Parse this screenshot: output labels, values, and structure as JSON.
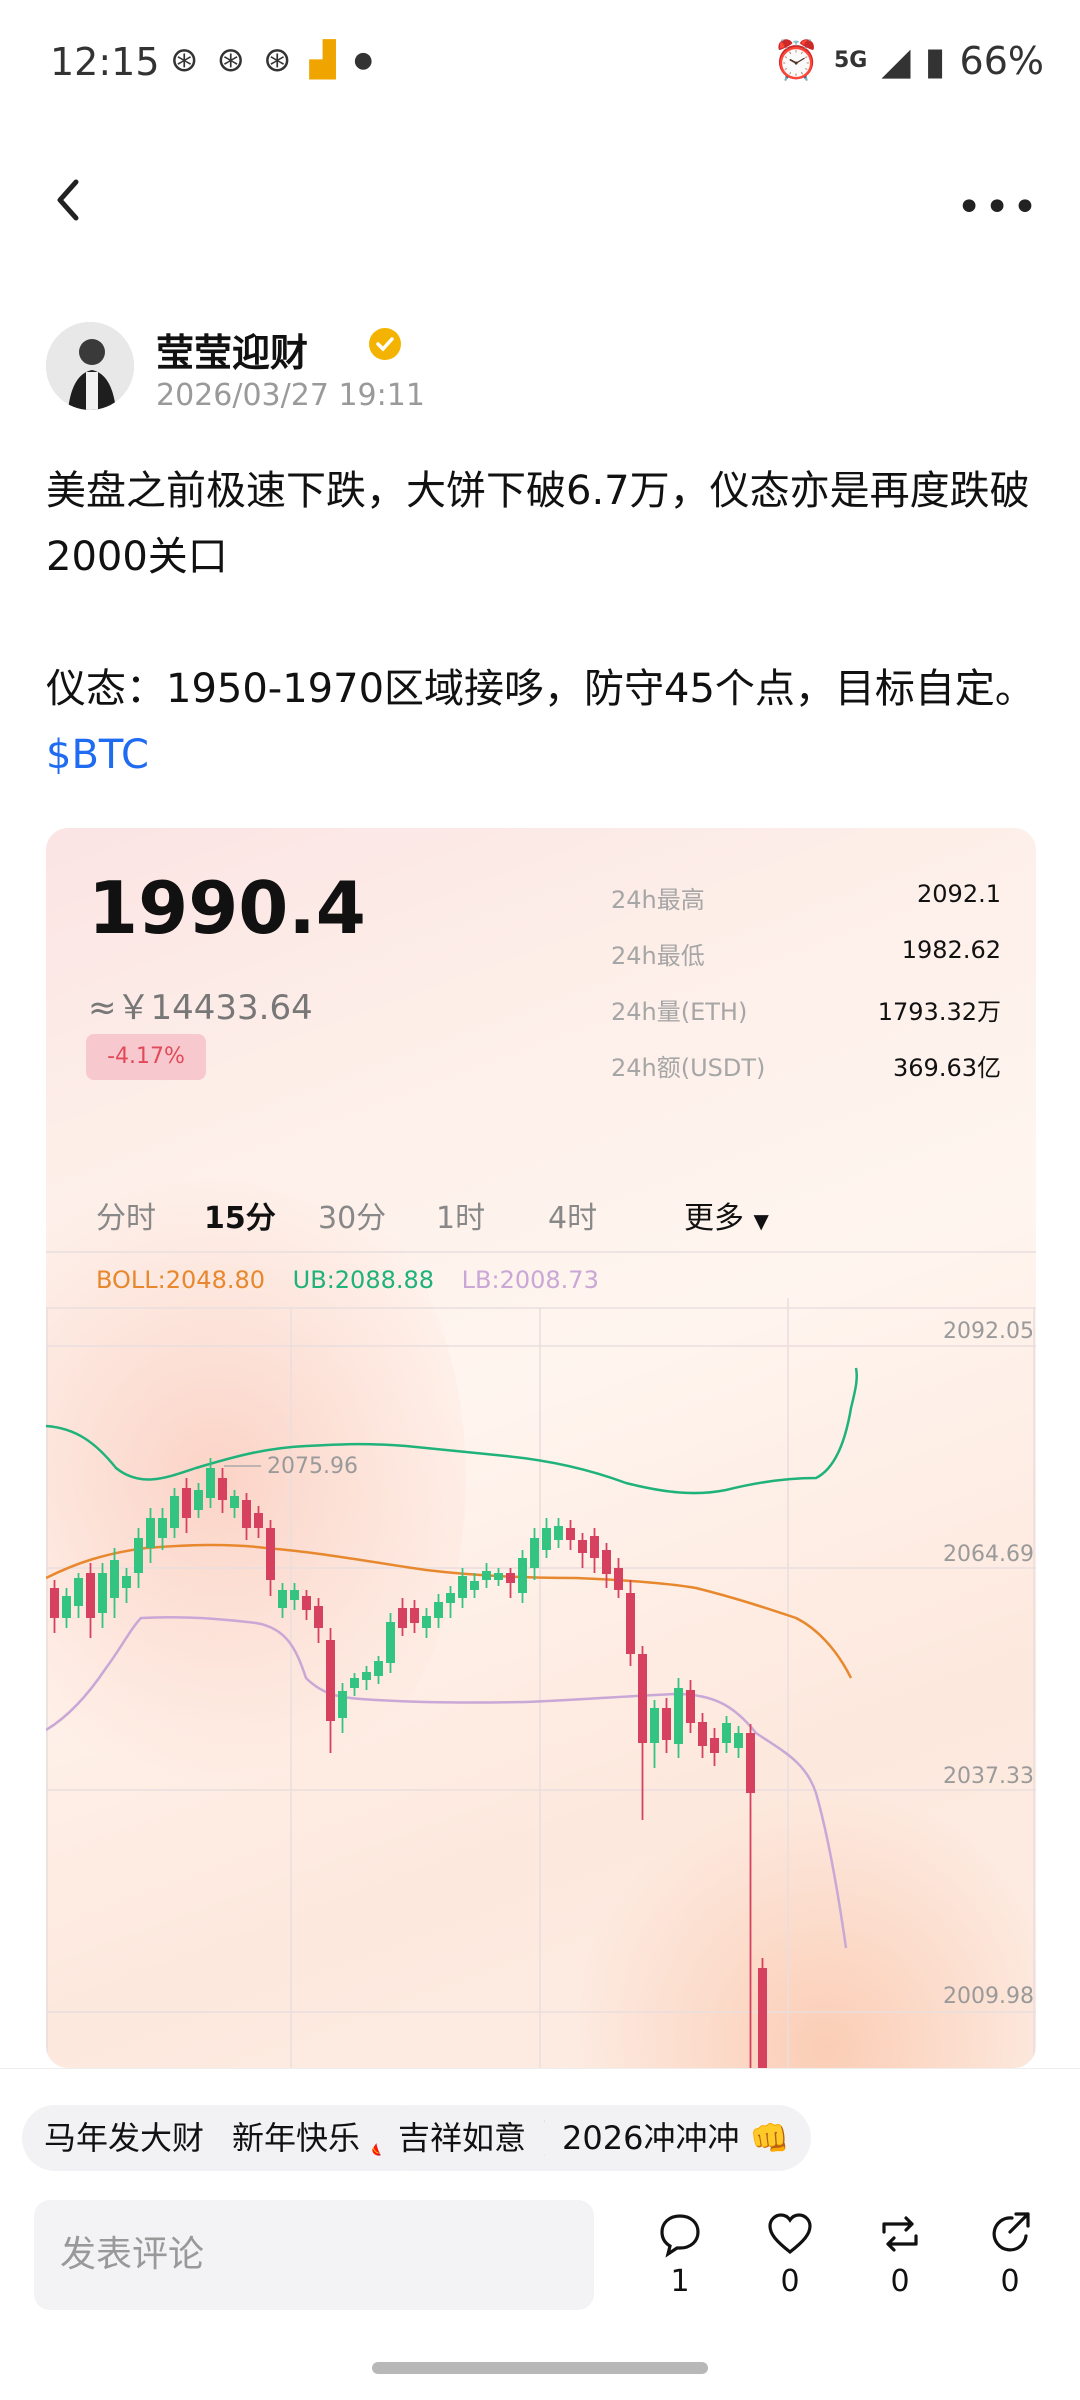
{
  "status": {
    "time": "12:15",
    "battery": "66%",
    "network": "5G"
  },
  "post": {
    "author": "莹莹迎财",
    "datetime": "2026/03/27 19:11",
    "para1": "美盘之前极速下跌，大饼下破6.7万，仪态亦是再度跌破2000关口",
    "para2": "仪态：1950-1970区域接哆，防守45个点，目标自定。",
    "ticker": "$BTC"
  },
  "card": {
    "price": "1990.4",
    "cny": "≈￥14433.64",
    "change": "-4.17%",
    "stats": [
      {
        "label": "24h最高",
        "value": "2092.1"
      },
      {
        "label": "24h最低",
        "value": "1982.62"
      },
      {
        "label": "24h量(ETH)",
        "value": "1793.32万"
      },
      {
        "label": "24h额(USDT)",
        "value": "369.63亿"
      }
    ],
    "tabs": [
      "分时",
      "15分",
      "30分",
      "1时",
      "4时",
      "更多"
    ],
    "boll": "BOLL:2048.80",
    "ub": "UB:2088.88",
    "lb": "LB:2008.73",
    "price_axis": [
      "2092.05",
      "2064.69",
      "2037.33",
      "2009.98"
    ],
    "max_label": "2075.96"
  },
  "chart_data": {
    "type": "candlestick",
    "y_ticks": [
      2092.05,
      2064.69,
      2037.33,
      2009.98
    ],
    "high_marker": 2075.96,
    "colors": {
      "up": "#33c481",
      "down": "#d6415f",
      "boll": "#e8882e",
      "ub": "#1fb27a",
      "lb": "#c9a7d6"
    }
  },
  "chips": [
    "马年发大财 🐴",
    "新年快乐 🧨",
    "吉祥如意 🧧",
    "2026冲冲冲 👊"
  ],
  "composer": {
    "placeholder": "发表评论"
  },
  "actions": [
    {
      "name": "comment",
      "count": "1"
    },
    {
      "name": "like",
      "count": "0"
    },
    {
      "name": "repost",
      "count": "0"
    },
    {
      "name": "share",
      "count": "0"
    }
  ]
}
